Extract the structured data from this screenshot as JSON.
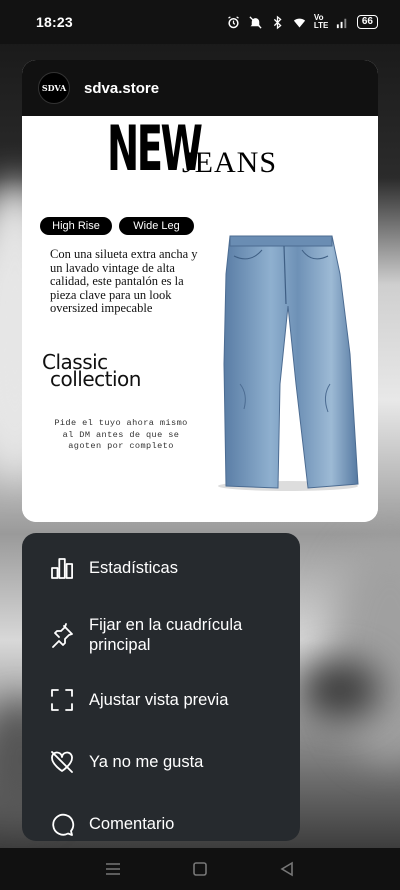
{
  "status_bar": {
    "time": "18:23",
    "network": "Vo LTE",
    "battery": "66",
    "icons": [
      "alarm-icon",
      "mute-icon",
      "bluetooth-icon",
      "wifi-icon",
      "signal-icon",
      "battery-icon"
    ]
  },
  "post": {
    "username": "sdva.store",
    "avatar_text": "SDVA",
    "title_new": "NEW",
    "title_jeans": "JEANS",
    "tags": [
      "High Rise",
      "Wide Leg"
    ],
    "description": "Con una silueta extra ancha y un lavado vintage de alta calidad, este pantalón es la pieza clave para un look oversized impecable",
    "classic_line1": "Classic",
    "classic_line2": "collection",
    "order_text": "Pide el tuyo ahora mismo al DM antes de que se agoten por completo"
  },
  "menu": {
    "items": [
      {
        "label": "Estadísticas",
        "icon": "bar-chart-icon"
      },
      {
        "label": "Fijar en la cuadrícula principal",
        "icon": "pin-icon"
      },
      {
        "label": "Ajustar vista previa",
        "icon": "crop-corners-icon"
      },
      {
        "label": "Ya no me gusta",
        "icon": "broken-heart-icon"
      },
      {
        "label": "Comentario",
        "icon": "comment-icon"
      }
    ]
  },
  "nav": {
    "icons": [
      "menu-icon",
      "home-icon",
      "back-icon"
    ]
  }
}
